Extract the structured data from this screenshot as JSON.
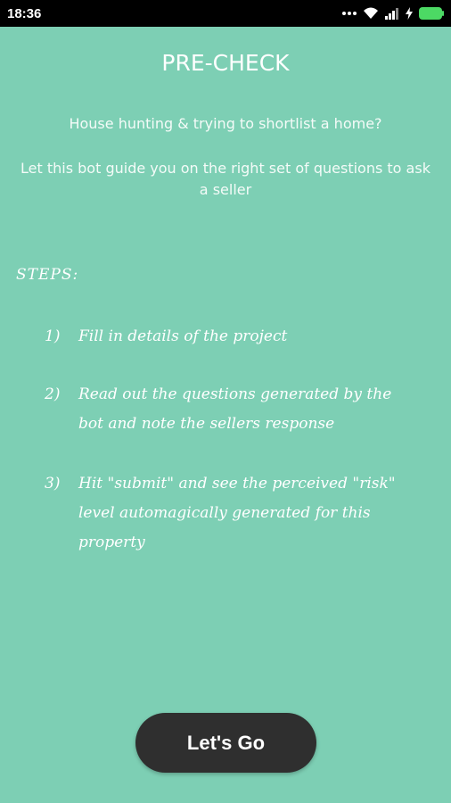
{
  "status_bar": {
    "time": "18:36",
    "icons": [
      "dots-icon",
      "wifi-icon",
      "signal-icon",
      "charging-icon",
      "battery-icon"
    ]
  },
  "title": "PRE-CHECK",
  "intro": {
    "line1": "House hunting & trying to shortlist a home?",
    "line2": "Let this bot guide you on the right set of questions to ask a seller"
  },
  "steps": {
    "label": "STEPS:",
    "items": [
      {
        "number": "1)",
        "text": "Fill in details of the project"
      },
      {
        "number": "2)",
        "text": "Read out the questions generated by the bot and note the sellers response"
      },
      {
        "number": "3)",
        "text": "Hit \"submit\" and see the perceived \"risk\" level automagically generated for this property"
      }
    ]
  },
  "button": {
    "label": "Let's Go"
  },
  "colors": {
    "background": "#7dcfb4",
    "button": "#2f2f2f",
    "battery": "#4cd964",
    "text": "#ffffff"
  }
}
